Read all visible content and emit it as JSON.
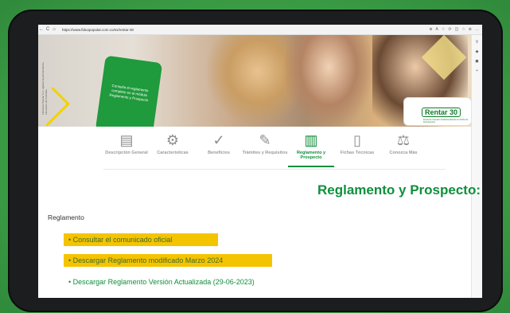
{
  "browser": {
    "url": "https://www.fiduopopular.com.co/es/rentar-30",
    "nav": [
      "←",
      "C",
      "⌂"
    ],
    "toolbar_icons": [
      "⊕",
      "A",
      "☆",
      "⟳",
      "◫",
      "☆",
      "⊕",
      "…"
    ]
  },
  "hero": {
    "card_text": "Consulta el reglamento completo en el módulo Reglamento y Prospecto",
    "badge": "Rentar 30",
    "badge_sub": "Fondo de Inversión Colectiva Abierto con Pacto de Permanencia",
    "vertical_text": "Fiduciaria Popular S.A. vigilada Superintendencia Financiera de Colombia"
  },
  "tabs": [
    {
      "label": "Descripción General",
      "icon": "document-icon"
    },
    {
      "label": "Características",
      "icon": "gears-icon"
    },
    {
      "label": "Beneficios",
      "icon": "check-circle-icon"
    },
    {
      "label": "Trámites y Requisitos",
      "icon": "edit-document-icon"
    },
    {
      "label": "Reglamento y Prospecto",
      "icon": "document-text-icon",
      "active": true
    },
    {
      "label": "Fichas Técnicas",
      "icon": "blank-document-icon"
    },
    {
      "label": "Conozca Más",
      "icon": "scales-icon"
    }
  ],
  "content": {
    "title": "Reglamento y Prospecto:",
    "section": "Reglamento",
    "links": [
      "• Consultar el comunicado oficial",
      "• Descargar Reglamento modificado Marzo 2024",
      "• Descargar Reglamento Versión Actualizada (29-06-2023)"
    ]
  },
  "colors": {
    "accent": "#0f8f3c",
    "highlight": "#f5c400"
  }
}
